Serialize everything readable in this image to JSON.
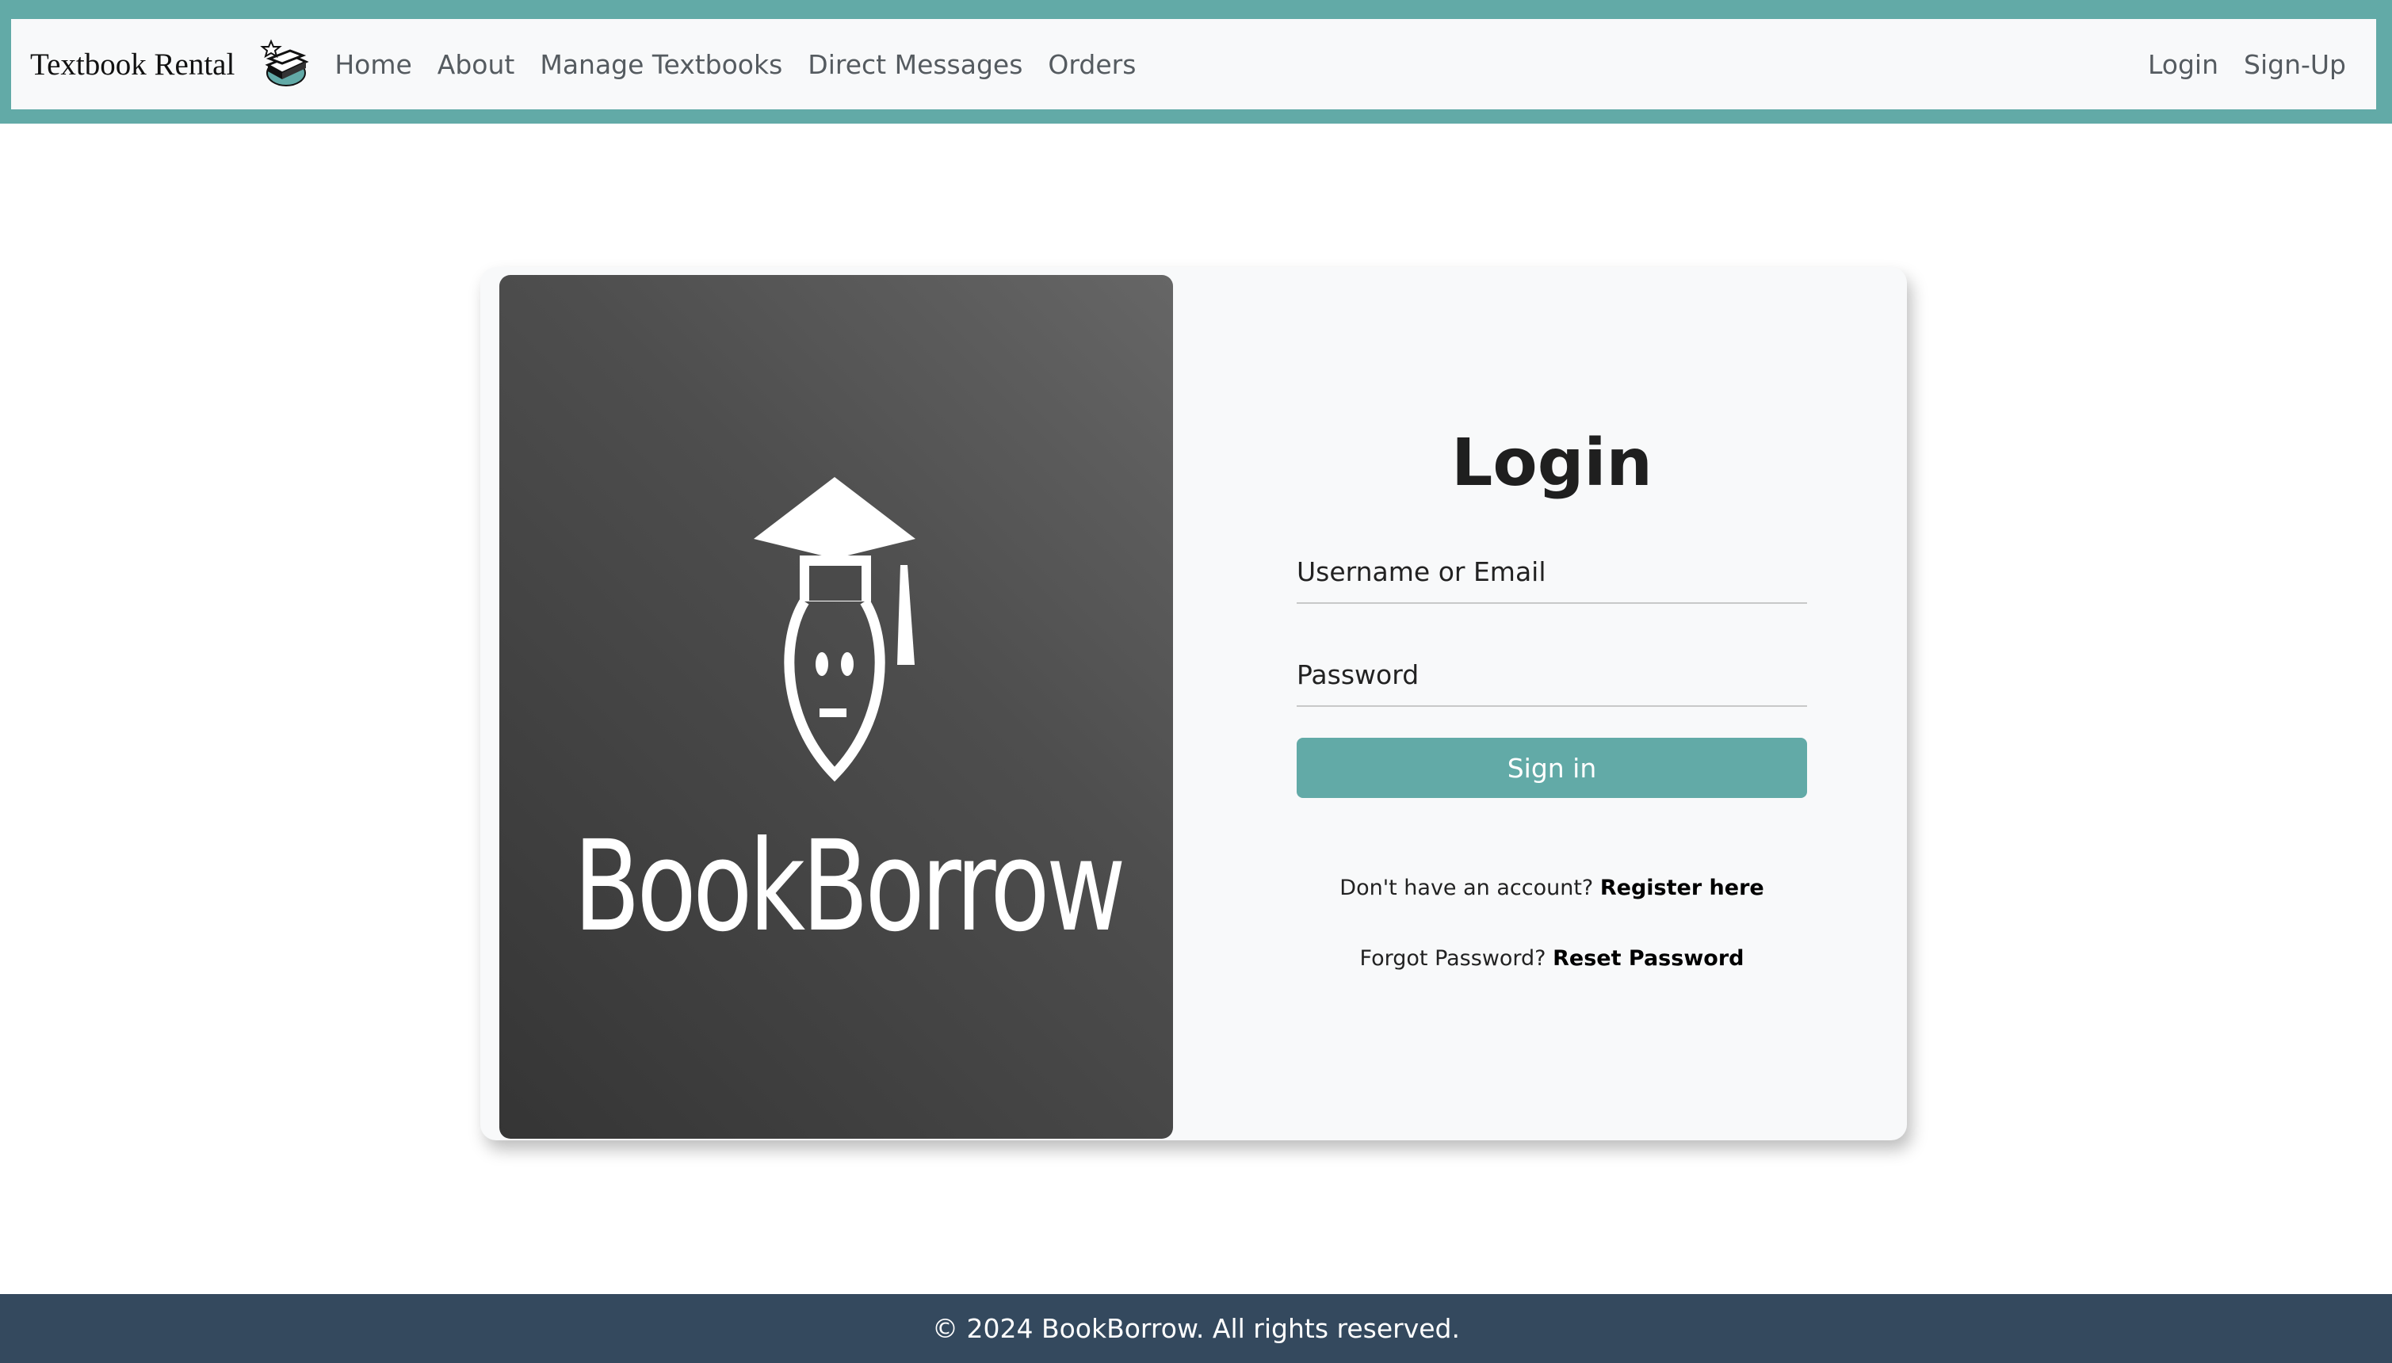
{
  "navbar": {
    "brand": "Textbook Rental",
    "brand_icon": "book-stack-icon",
    "links": [
      "Home",
      "About",
      "Manage Textbooks",
      "Direct Messages",
      "Orders"
    ],
    "right_links": [
      "Login",
      "Sign-Up"
    ],
    "accent_color": "#62aaa7"
  },
  "hero": {
    "logo_icon": "graduation-cap-mascot-icon",
    "title": "BookBorrow"
  },
  "login": {
    "title": "Login",
    "username_placeholder": "Username or Email",
    "password_placeholder": "Password",
    "submit_label": "Sign in",
    "register_prompt": "Don't have an account?",
    "register_link": "Register here",
    "reset_prompt": "Forgot Password?",
    "reset_link": "Reset Password",
    "button_color": "#62aaa7"
  },
  "footer": {
    "text": "© 2024 BookBorrow. All rights reserved.",
    "background_color": "#34495e"
  }
}
